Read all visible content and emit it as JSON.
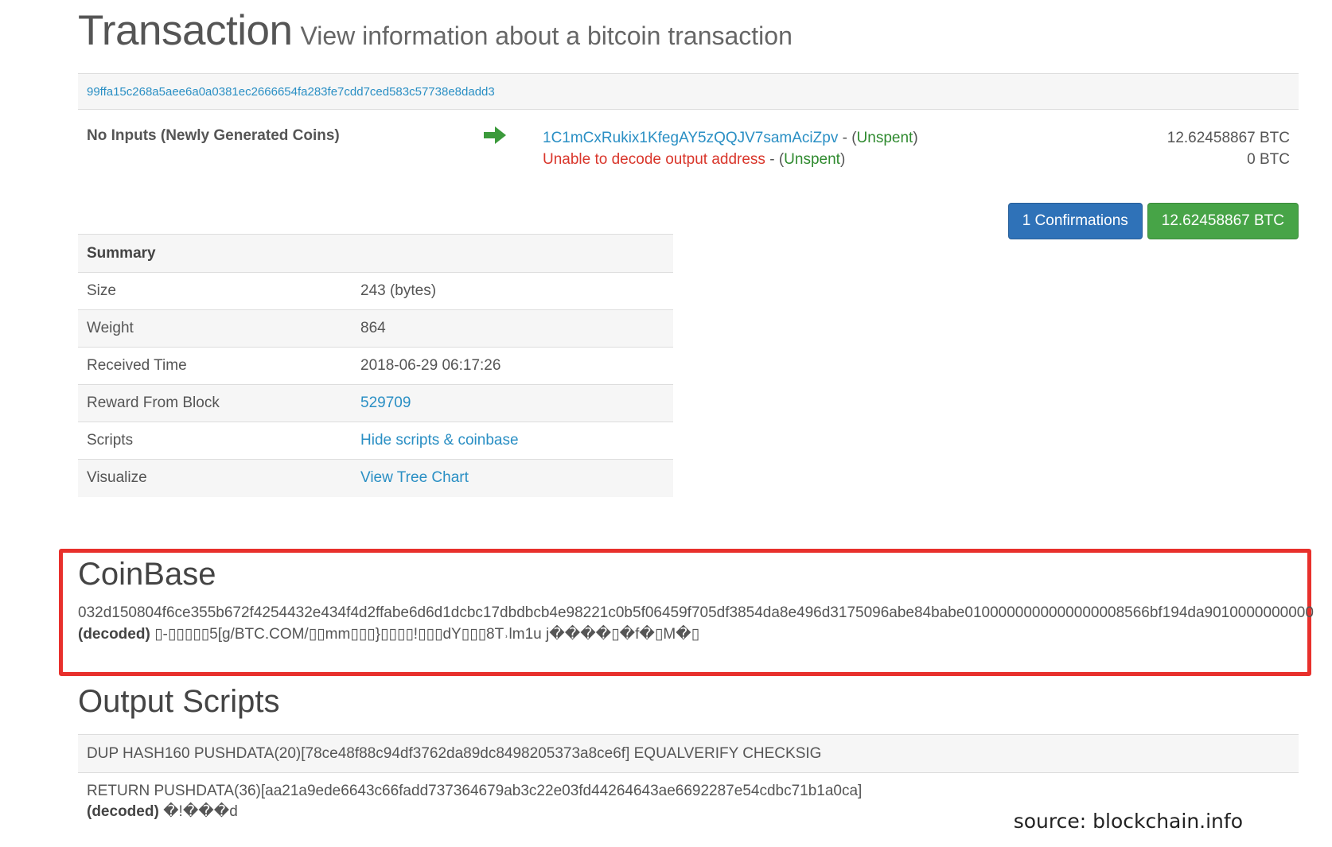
{
  "header": {
    "title": "Transaction",
    "subtitle": "View information about a bitcoin transaction"
  },
  "transaction": {
    "hash": "99ffa15c268a5aee6a0a0381ec2666654fa283fe7cdd7ced583c57738e8dadd3",
    "inputs_label": "No Inputs (Newly Generated Coins)",
    "outputs": [
      {
        "address": "1C1mCxRukix1KfegAY5zQQJV7samAciZpv",
        "sep": " - (",
        "status": "Unspent",
        "close": ")",
        "amount": "12.62458867 BTC"
      },
      {
        "address": "Unable to decode output address",
        "sep": " - (",
        "status": "Unspent",
        "close": ")",
        "amount": "0 BTC"
      }
    ],
    "confirmations_label": "1 Confirmations",
    "total_label": "12.62458867 BTC"
  },
  "summary": {
    "heading": "Summary",
    "rows": [
      {
        "label": "Size",
        "value": "243 (bytes)"
      },
      {
        "label": "Weight",
        "value": "864"
      },
      {
        "label": "Received Time",
        "value": "2018-06-29 06:17:26"
      },
      {
        "label": "Reward From Block",
        "value": "529709"
      },
      {
        "label": "Scripts",
        "value": "Hide scripts & coinbase"
      },
      {
        "label": "Visualize",
        "value": "View Tree Chart"
      }
    ]
  },
  "coinbase": {
    "title": "CoinBase",
    "hex": "032d150804f6ce355b672f4254432e434f4d2ffabe6d6d1dcbc17dbdbcb4e98221c0b5f06459f705df3854da8e496d3175096abe84babe0100000000000000008566bf194da9010000000000",
    "decoded_label": "(decoded)",
    "decoded_value": "▯-▯▯▯▯▯5[g/BTC.COM/▯▯mm▯▯▯}▯▯▯▯!▯▯▯dY▯▯▯8T˒lm1u j����▯�f�▯M�▯"
  },
  "output_scripts": {
    "title": "Output Scripts",
    "script1": "DUP HASH160 PUSHDATA(20)[78ce48f88c94df3762da89dc8498205373a8ce6f] EQUALVERIFY CHECKSIG",
    "script2": "RETURN PUSHDATA(36)[aa21a9ede6643c66fadd737364679ab3c22e03fd44264643ae6692287e54cdbc71b1a0ca]",
    "decoded_label": "(decoded)",
    "decoded_value": "�!���d"
  },
  "source": "source: blockchain.info",
  "colors": {
    "link": "#2a8fc4",
    "unspent": "#2f8a2f",
    "error": "#d9362b",
    "highlight_border": "#e8302c",
    "confirm_button": "#2f72b8",
    "amount_button": "#47a447"
  },
  "icons": {
    "arrow": "arrow-right-icon"
  }
}
